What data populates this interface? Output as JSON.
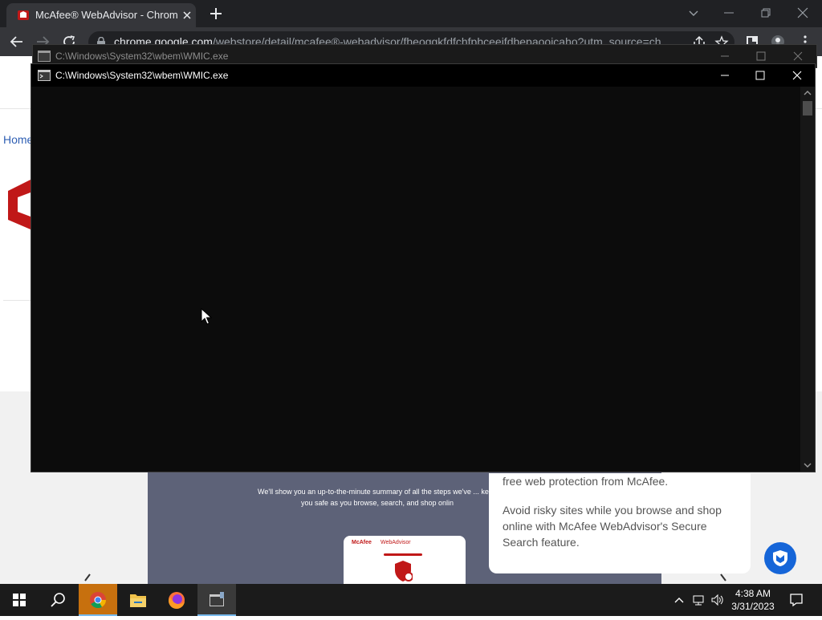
{
  "browser": {
    "tab_title": "McAfee® WebAdvisor - Chrome",
    "url_host": "chrome.google.com",
    "url_path": "/webstore/detail/mcafee®-webadvisor/fheoggkfdfchfphceeifdbepaooicaho?utm_source=ch"
  },
  "page": {
    "breadcrumb_home": "Home",
    "promo_text": "We'll show you an up-to-the-minute summary of all the steps we've ... keep you safe as you browse, search, and shop onlin",
    "mini_card_brand": "McAfee",
    "mini_card_app": "WebAdvisor",
    "card_line1": "free web protection from McAfee.",
    "card_line2": "Avoid risky sites while you browse and shop online with McAfee WebAdvisor's Secure Search feature."
  },
  "console_back": {
    "title": "C:\\Windows\\System32\\wbem\\WMIC.exe"
  },
  "console": {
    "title": "C:\\Windows\\System32\\wbem\\WMIC.exe"
  },
  "taskbar": {
    "apps": [
      "chrome-icon",
      "file-explorer-icon",
      "firefox-icon",
      "wmic-icon"
    ],
    "time": "4:38 AM",
    "date": "3/31/2023"
  },
  "colors": {
    "console_bg": "#0c0c0c",
    "taskbar_bg": "#1b1b1b",
    "mcafee_red": "#c01818",
    "chrome_accent": "#c7700e"
  }
}
